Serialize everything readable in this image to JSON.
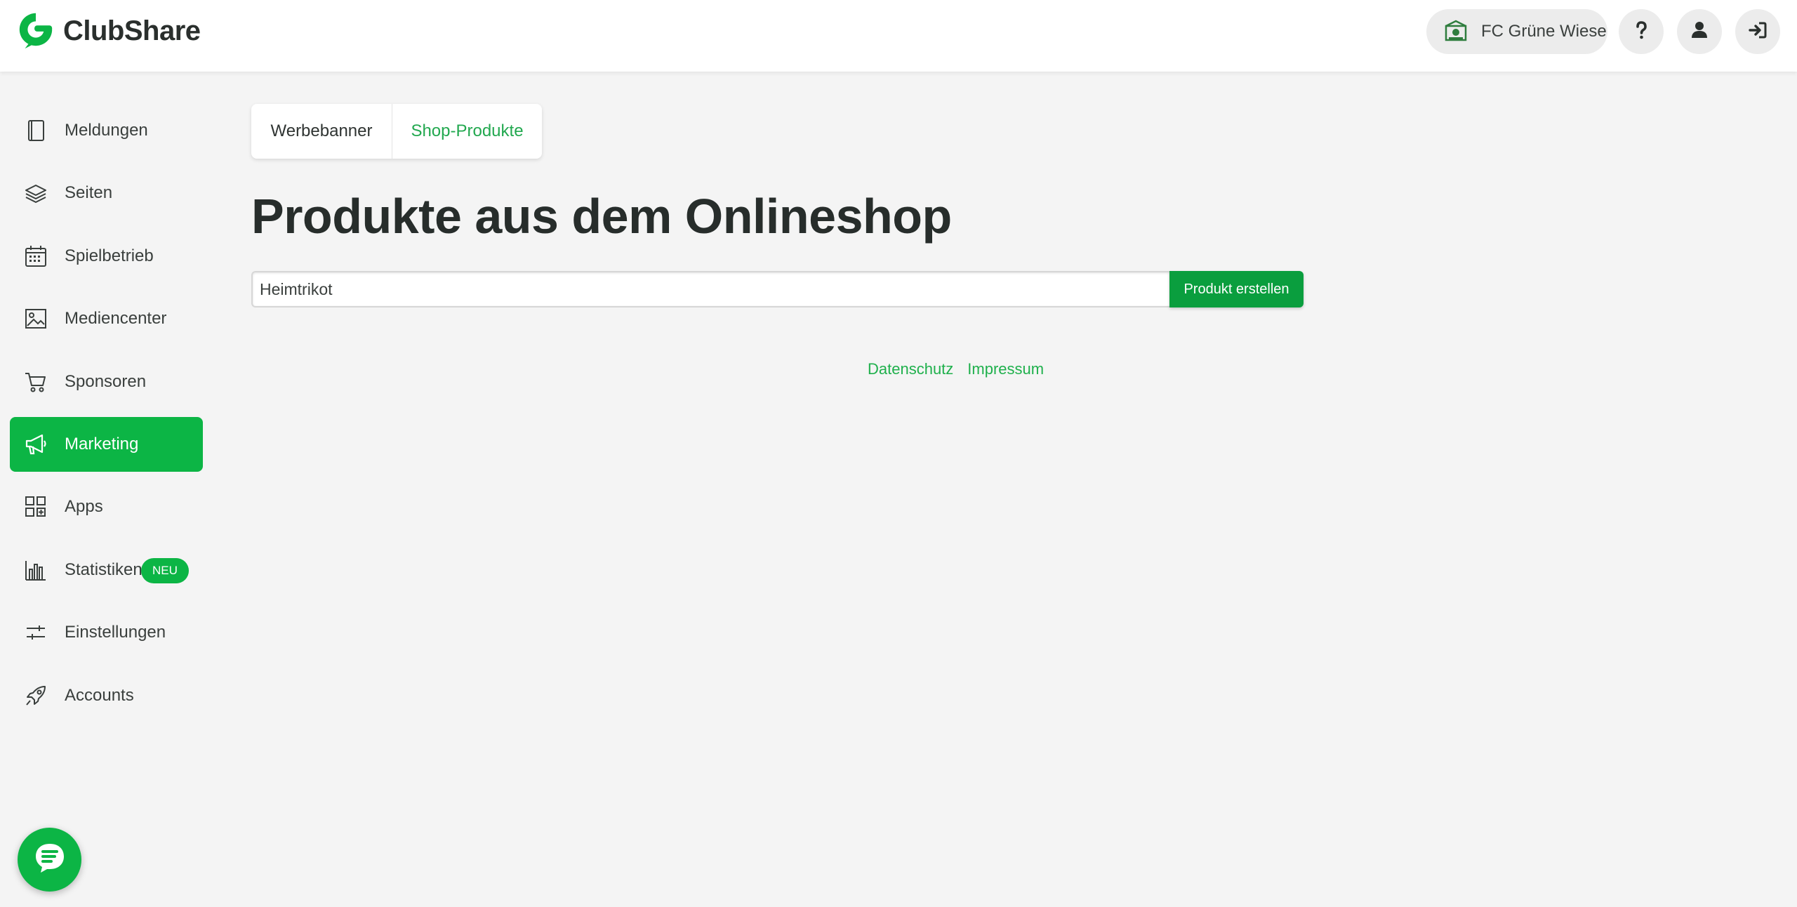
{
  "header": {
    "brand_name": "ClubShare",
    "club_name": "FC Grüne Wiese",
    "icons": {
      "logo": "clubshare-logo-icon",
      "crest": "club-crest-icon",
      "help": "question-mark-icon",
      "profile": "user-icon",
      "logout": "sign-out-icon"
    }
  },
  "sidebar": {
    "items": [
      {
        "label": "Meldungen",
        "icon": "book-icon"
      },
      {
        "label": "Seiten",
        "icon": "layers-icon"
      },
      {
        "label": "Spielbetrieb",
        "icon": "calendar-icon"
      },
      {
        "label": "Mediencenter",
        "icon": "image-icon"
      },
      {
        "label": "Sponsoren",
        "icon": "cart-icon"
      },
      {
        "label": "Marketing",
        "icon": "megaphone-icon",
        "active": true
      },
      {
        "label": "Apps",
        "icon": "apps-grid-icon"
      },
      {
        "label": "Statistiken",
        "icon": "bar-chart-icon",
        "badge": "NEU"
      },
      {
        "label": "Einstellungen",
        "icon": "sliders-icon"
      },
      {
        "label": "Accounts",
        "icon": "rocket-icon"
      }
    ]
  },
  "main": {
    "tabs": [
      {
        "label": "Werbebanner",
        "active": false
      },
      {
        "label": "Shop-Produkte",
        "active": true
      }
    ],
    "title": "Produkte aus dem Onlineshop",
    "search": {
      "value": "Heimtrikot"
    },
    "create_button_label": "Produkt erstellen"
  },
  "footer": {
    "links": [
      "Datenschutz",
      "Impressum"
    ]
  },
  "chat": {
    "icon": "chat-bubble-icon"
  },
  "colors": {
    "accent": "#0cb545",
    "accent_dark": "#0a9e3e",
    "link": "#1fb04c",
    "background": "#f4f4f4"
  }
}
